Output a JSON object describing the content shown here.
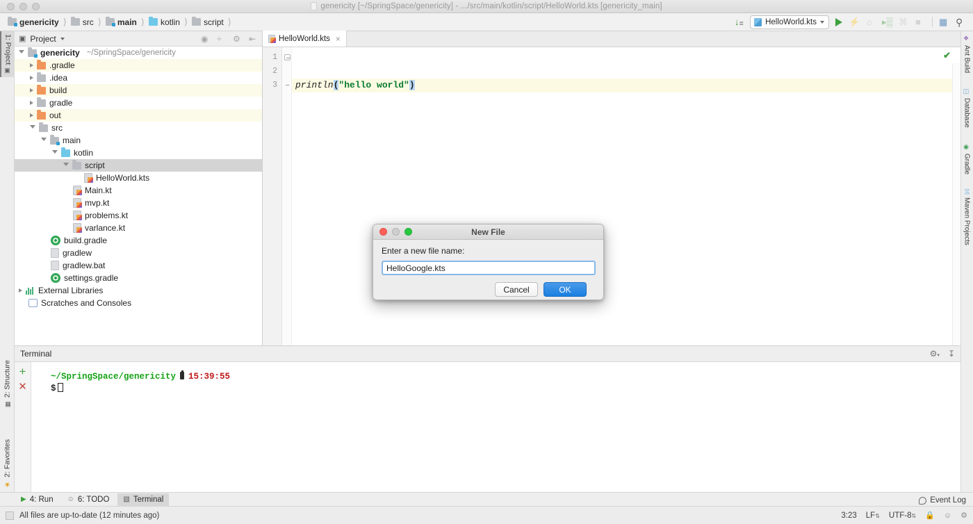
{
  "window": {
    "title": "genericity [~/SpringSpace/genericity] - .../src/main/kotlin/script/HelloWorld.kts [genericity_main]",
    "doc_icon": "document-icon"
  },
  "breadcrumb": {
    "items": [
      {
        "label": "genericity",
        "icon": "module-folder-icon",
        "bold": true
      },
      {
        "label": "src",
        "icon": "folder-icon",
        "bold": false
      },
      {
        "label": "main",
        "icon": "source-folder-icon",
        "bold": true
      },
      {
        "label": "kotlin",
        "icon": "source-root-folder-icon",
        "bold": false
      },
      {
        "label": "script",
        "icon": "package-folder-icon",
        "bold": false
      }
    ],
    "separator": "〉"
  },
  "toolbar": {
    "sort_icon": "sort-numeric-icon",
    "run_config": "HelloWorld.kts",
    "run_config_icon": "kotlin-script-icon",
    "dropdown_icon": "chevron-down-icon",
    "run_icon": "run-icon",
    "debug_icon": "debug-icon",
    "coverage_icon": "run-with-coverage-icon",
    "profile_icon": "profiler-icon",
    "attach_icon": "attach-process-icon",
    "stop_icon": "stop-icon",
    "layout_icon": "toggle-layout-icon",
    "search_icon": "search-everywhere-icon"
  },
  "left_strip": {
    "tabs": [
      {
        "label": "1: Project",
        "icon": "project-icon",
        "selected": true
      },
      {
        "label": "2: Structure",
        "icon": "structure-icon",
        "selected": false
      },
      {
        "label": "2: Favorites",
        "icon": "favorites-star-icon",
        "selected": false
      }
    ]
  },
  "right_strip": {
    "tabs": [
      {
        "label": "Ant Build",
        "icon": "ant-icon"
      },
      {
        "label": "Database",
        "icon": "database-icon"
      },
      {
        "label": "Gradle",
        "icon": "gradle-icon"
      },
      {
        "label": "Maven Projects",
        "icon": "maven-icon"
      }
    ]
  },
  "project_panel": {
    "title": "Project",
    "title_icon": "project-view-icon",
    "title_dropdown": "chevron-down-icon",
    "actions": [
      {
        "name": "locate-icon"
      },
      {
        "name": "collapse-all-icon"
      },
      {
        "name": "settings-gear-icon"
      },
      {
        "name": "hide-panel-icon"
      }
    ],
    "tree": [
      {
        "label": "genericity",
        "path": "~/SpringSpace/genericity",
        "icon": "module-folder-icon",
        "indent": 0,
        "state": "open",
        "bold": true,
        "tint": false,
        "selected": false
      },
      {
        "label": ".gradle",
        "icon": "folder-orange-icon",
        "indent": 1,
        "state": "closed",
        "bold": false,
        "tint": true,
        "selected": false
      },
      {
        "label": ".idea",
        "icon": "folder-gray-icon",
        "indent": 1,
        "state": "closed",
        "bold": false,
        "tint": false,
        "selected": false
      },
      {
        "label": "build",
        "icon": "folder-orange-icon",
        "indent": 1,
        "state": "closed",
        "bold": false,
        "tint": true,
        "selected": false
      },
      {
        "label": "gradle",
        "icon": "folder-gray-icon",
        "indent": 1,
        "state": "closed",
        "bold": false,
        "tint": false,
        "selected": false
      },
      {
        "label": "out",
        "icon": "folder-orange-icon",
        "indent": 1,
        "state": "closed",
        "bold": false,
        "tint": true,
        "selected": false
      },
      {
        "label": "src",
        "icon": "folder-gray-icon",
        "indent": 1,
        "state": "open",
        "bold": false,
        "tint": false,
        "selected": false
      },
      {
        "label": "main",
        "icon": "source-folder-icon",
        "indent": 2,
        "state": "open",
        "bold": false,
        "tint": false,
        "selected": false
      },
      {
        "label": "kotlin",
        "icon": "source-root-folder-icon",
        "indent": 3,
        "state": "open",
        "bold": false,
        "tint": false,
        "selected": false
      },
      {
        "label": "script",
        "icon": "package-folder-icon",
        "indent": 4,
        "state": "open",
        "bold": false,
        "tint": false,
        "selected": true
      },
      {
        "label": "HelloWorld.kts",
        "icon": "kotlin-script-file-icon",
        "indent": 5,
        "state": "leaf",
        "bold": false,
        "tint": false,
        "selected": false
      },
      {
        "label": "Main.kt",
        "icon": "kotlin-file-icon",
        "indent": 4,
        "state": "leaf",
        "bold": false,
        "tint": false,
        "selected": false
      },
      {
        "label": "mvp.kt",
        "icon": "kotlin-file-icon",
        "indent": 4,
        "state": "leaf",
        "bold": false,
        "tint": false,
        "selected": false
      },
      {
        "label": "problems.kt",
        "icon": "kotlin-file-icon",
        "indent": 4,
        "state": "leaf",
        "bold": false,
        "tint": false,
        "selected": false
      },
      {
        "label": "varlance.kt",
        "icon": "kotlin-file-icon",
        "indent": 4,
        "state": "leaf",
        "bold": false,
        "tint": false,
        "selected": false
      },
      {
        "label": "build.gradle",
        "icon": "gradle-build-icon",
        "indent": 2,
        "state": "leaf",
        "bold": false,
        "tint": false,
        "selected": false
      },
      {
        "label": "gradlew",
        "icon": "generic-file-icon",
        "indent": 2,
        "state": "leaf",
        "bold": false,
        "tint": false,
        "selected": false
      },
      {
        "label": "gradlew.bat",
        "icon": "generic-file-icon",
        "indent": 2,
        "state": "leaf",
        "bold": false,
        "tint": false,
        "selected": false
      },
      {
        "label": "settings.gradle",
        "icon": "gradle-build-icon",
        "indent": 2,
        "state": "leaf",
        "bold": false,
        "tint": false,
        "selected": false
      },
      {
        "label": "External Libraries",
        "icon": "external-libraries-icon",
        "indent": 0,
        "state": "closed",
        "bold": false,
        "tint": false,
        "selected": false
      },
      {
        "label": "Scratches and Consoles",
        "icon": "scratches-icon",
        "indent": 0,
        "state": "leaf",
        "bold": false,
        "tint": false,
        "selected": false
      }
    ]
  },
  "editor": {
    "tab_label": "HelloWorld.kts",
    "tab_icon": "kotlin-script-file-icon",
    "tab_close": "×",
    "line_numbers": [
      "1",
      "2",
      "3"
    ],
    "lines": [
      {
        "text": "",
        "highlight": false
      },
      {
        "text": "",
        "highlight": false
      },
      {
        "text": "println(\"hello world\")",
        "highlight": true
      }
    ],
    "code_tokens": {
      "fn": "println",
      "open_paren": "(",
      "string": "\"hello world\"",
      "close_paren": ")"
    },
    "inspection_status": "✔"
  },
  "terminal": {
    "title": "Terminal",
    "add_tab_icon": "plus-icon",
    "close_tab_icon": "close-x-icon",
    "settings_icon": "settings-gear-icon",
    "hide_icon": "hide-panel-icon",
    "prompt_path": "~/SpringSpace/genericity",
    "battery_icon": "battery-icon",
    "time": "15:39:55",
    "dollar": "$",
    "cursor": "cursor-block"
  },
  "dialog": {
    "title": "New File",
    "label": "Enter a new file name:",
    "input_value": "HelloGoogle.kts",
    "input_placeholder": "",
    "cancel_label": "Cancel",
    "ok_label": "OK",
    "accent_color": "#1a7fe0",
    "close_icon": "close-traffic-light",
    "minimize_icon": "minimize-traffic-light",
    "zoom_icon": "zoom-traffic-light"
  },
  "tool_windows": [
    {
      "label": "4: Run",
      "mnemonic": "4",
      "icon": "run-icon",
      "active": false
    },
    {
      "label": "6: TODO",
      "mnemonic": "6",
      "icon": "todo-icon",
      "active": false
    },
    {
      "label": "Terminal",
      "mnemonic": "",
      "icon": "terminal-icon",
      "active": true
    }
  ],
  "status_bar": {
    "message": "All files are up-to-date (12 minutes ago)",
    "message_icon": "build-status-icon",
    "event_log": "Event Log",
    "event_log_icon": "event-log-icon",
    "caret_position": "3:23",
    "line_separator": "LF",
    "encoding": "UTF-8",
    "lock_icon": "lock-icon",
    "inspector_icon": "inspection-face-icon",
    "gear_icon": "settings-gear-icon"
  }
}
